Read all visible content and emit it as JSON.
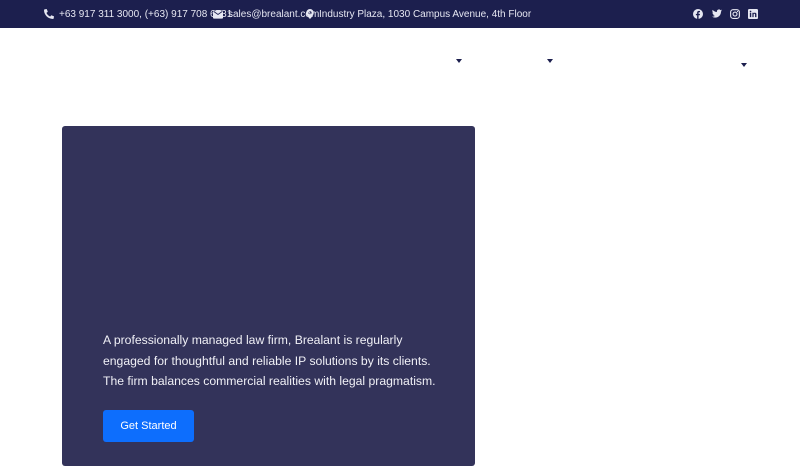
{
  "topbar": {
    "phone": "+63 917 311 3000, (+63) 917 708 6731",
    "email": "sales@brealant.com",
    "address": "Industry Plaza, 1030 Campus Avenue, 4th Floor",
    "socials": [
      {
        "icon": "facebook-icon"
      },
      {
        "icon": "twitter-icon"
      },
      {
        "icon": "instagram-icon"
      },
      {
        "icon": "linkedin-icon"
      }
    ]
  },
  "hero": {
    "description": "A professionally managed law firm, Brealant is regularly engaged for thoughtful and reliable IP solutions by its clients. The firm balances commercial realities with legal pragmatism.",
    "cta_label": "Get Started"
  },
  "colors": {
    "topbar_bg": "#1c1f4e",
    "hero_bg": "#33335a",
    "accent": "#0d6efd"
  }
}
